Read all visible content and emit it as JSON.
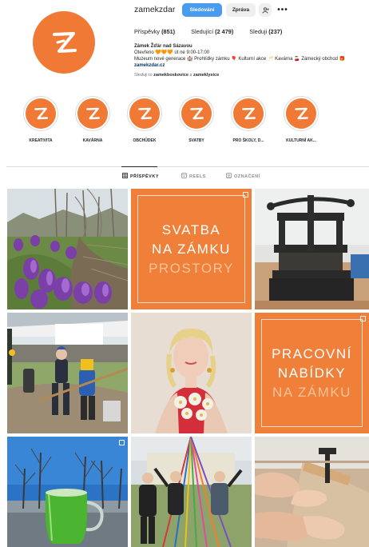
{
  "profile": {
    "username": "zamekzdar",
    "follow_label": "Sledování",
    "message_label": "Zpráva",
    "suggest_label": "+ጸ",
    "more_label": "•••"
  },
  "stats": {
    "posts_label": "Příspěvky",
    "posts_count": "(851)",
    "followers_label": "Sledující",
    "followers_count": "(2 479)",
    "following_label": "Sleduji",
    "following_count": "(237)"
  },
  "bio": {
    "name": "Zámek Žďár nad Sázavou",
    "line1": "Otevřeno 🧡🧡🧡 út ne 9:00-17:00",
    "line2": "Muzeum nové generace 🏰 Prohlídky zámku 🎈 Kulturní akce 🥂 Kavárna 🍒 Zámecký obchod 🎁",
    "link": "zamekzdar.cz",
    "followed_prefix": "Sleduji to",
    "followed_user1": "zamekboskovice",
    "followed_and": "a",
    "followed_user2": "zameklysice"
  },
  "highlights": [
    {
      "label": "KREATIVITA"
    },
    {
      "label": "KAVÁRNA"
    },
    {
      "label": "OBCHŮDEK"
    },
    {
      "label": "SVATBY"
    },
    {
      "label": "PRO ŠKOLY, D..."
    },
    {
      "label": "KULTURNÍ AK..."
    }
  ],
  "tabs": [
    {
      "label": "PŘÍSPĚVKY",
      "icon": "grid-icon",
      "active": true
    },
    {
      "label": "REELS",
      "icon": "reels-icon",
      "active": false
    },
    {
      "label": "OZNAČENÍ",
      "icon": "tag-icon",
      "active": false
    }
  ],
  "posts": {
    "wedding": {
      "line1": "SVATBA",
      "line2": "NA ZÁMKU",
      "line3": "PROSTORY"
    },
    "jobs": {
      "line1": "PRACOVNÍ",
      "line2": "NABÍDKY",
      "line3": "NA ZÁMKU"
    }
  },
  "colors": {
    "brand_orange": "#f07a35",
    "follow_blue": "#4a9bf0"
  }
}
